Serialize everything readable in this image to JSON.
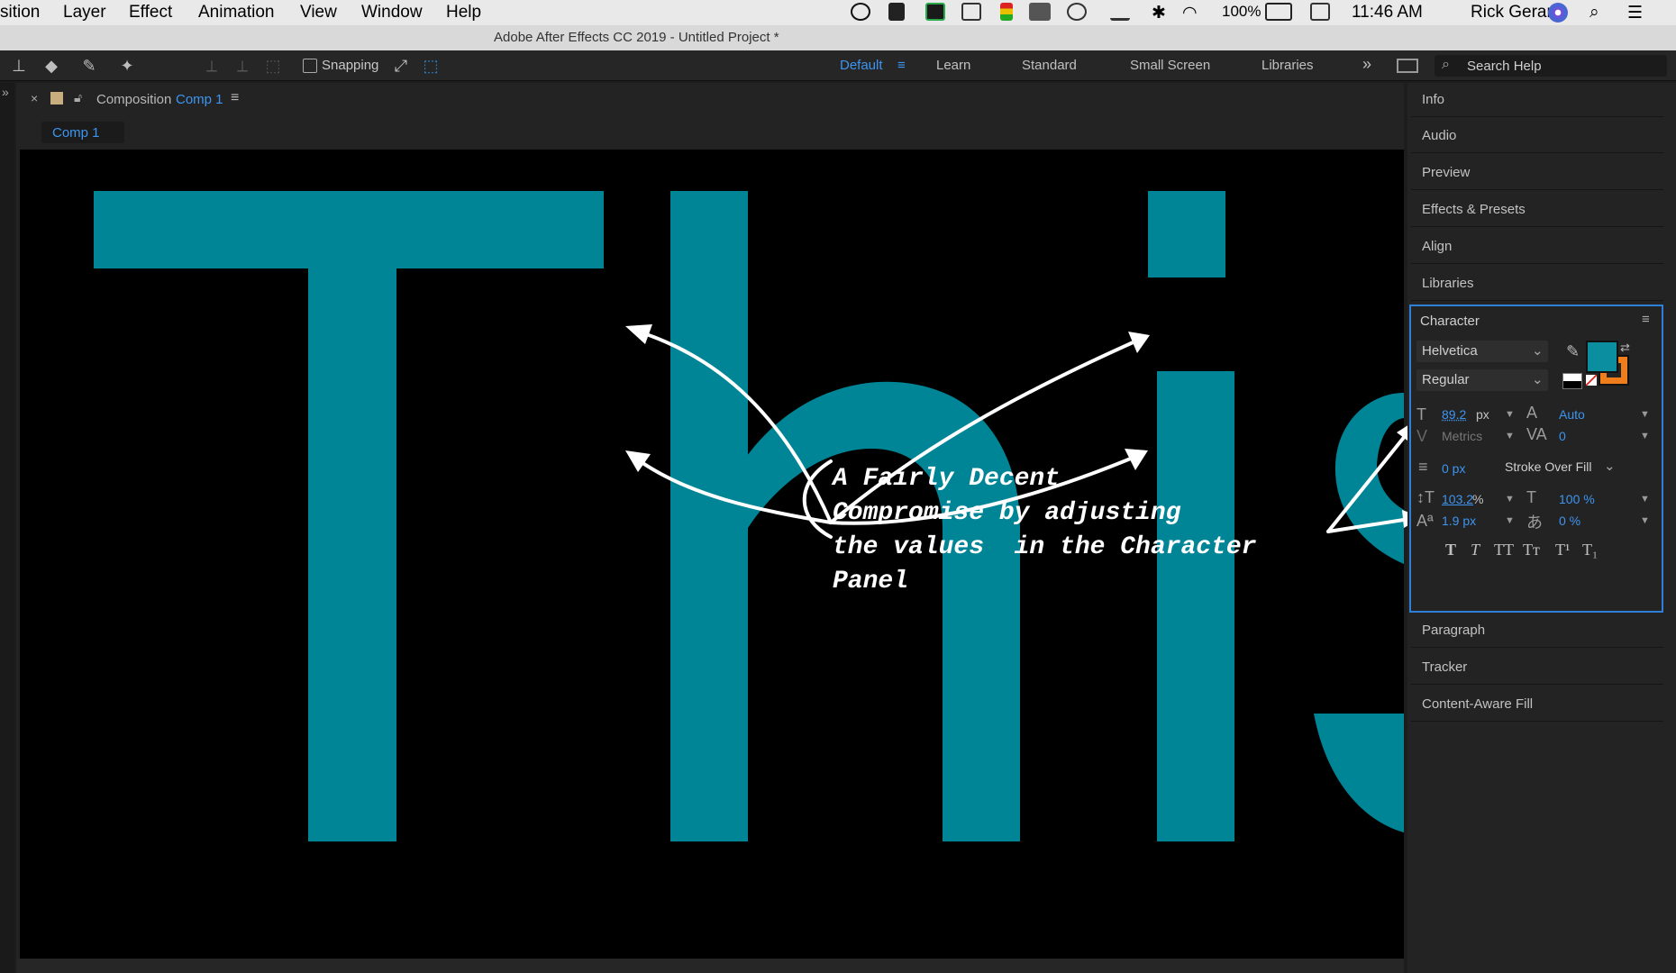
{
  "menubar": {
    "items": [
      "sition",
      "Layer",
      "Effect",
      "Animation",
      "View",
      "Window",
      "Help"
    ],
    "battery": "100%",
    "time": "11:46 AM",
    "user": "Rick Gerard"
  },
  "titlebar": {
    "title": "Adobe After Effects CC 2019 - Untitled Project *"
  },
  "toolbar": {
    "snapping_label": "Snapping",
    "workspaces": [
      "Default",
      "Learn",
      "Standard",
      "Small Screen",
      "Libraries"
    ],
    "search_placeholder": "Search Help"
  },
  "comp_panel": {
    "tab_prefix": "Composition",
    "tab_name": "Comp 1",
    "flowchart_tab": "Comp 1"
  },
  "viewer": {
    "text_color": "#008596",
    "annotation": [
      "A Fairly Decent",
      "Compromise by adjusting",
      "the values  in the Character",
      "Panel"
    ]
  },
  "right_panels": {
    "top": [
      "Info",
      "Audio",
      "Preview",
      "Effects & Presets",
      "Align",
      "Libraries"
    ],
    "bottom": [
      "Paragraph",
      "Tracker",
      "Content-Aware Fill"
    ]
  },
  "character": {
    "title": "Character",
    "font_family": "Helvetica",
    "font_style": "Regular",
    "fill_color": "#0b8fa0",
    "stroke_color": "#f07d1b",
    "font_size": "89.2",
    "font_size_unit": "px",
    "leading": "Auto",
    "kerning": "Metrics",
    "tracking": "0",
    "stroke_width": "0 px",
    "stroke_mode": "Stroke Over Fill",
    "vertical_scale": "103.2",
    "vertical_scale_unit": "%",
    "horizontal_scale": "100 %",
    "baseline_shift": "1.9 px",
    "tsume": "0 %",
    "format_buttons": [
      "T",
      "T",
      "TT",
      "Tт",
      "T¹",
      "T₁"
    ]
  }
}
